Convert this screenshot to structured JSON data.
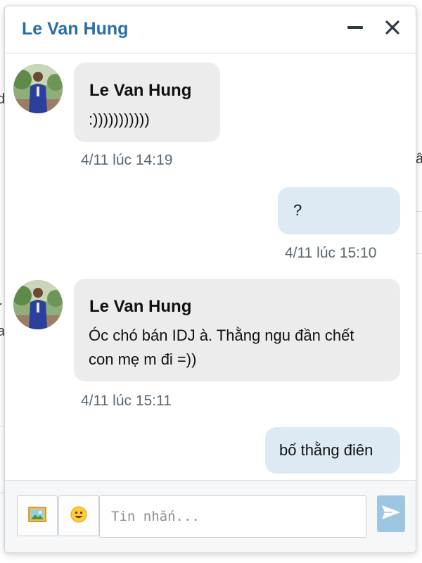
{
  "chat": {
    "title": "Le Van Hung",
    "messages": [
      {
        "direction": "in",
        "sender": "Le Van Hung",
        "text": ":)))))))))))",
        "timestamp": "4/11 lúc 14:19"
      },
      {
        "direction": "out",
        "text": "?",
        "timestamp": "4/11 lúc 15:10"
      },
      {
        "direction": "in",
        "sender": "Le Van Hung",
        "text_line1": "Óc chó bán IDJ à. Thằng ngu đần chết",
        "text_line2": "con mẹ m đi =))",
        "timestamp": "4/11 lúc 15:11"
      },
      {
        "direction": "out",
        "text": "bố thằng điên"
      }
    ]
  },
  "composer": {
    "placeholder": "Tin nhắn...",
    "image_icon": "image-icon",
    "emoji_icon": "emoji-icon",
    "send_icon": "send-icon"
  },
  "colors": {
    "title": "#2a6ea6",
    "bubble_in": "#ececec",
    "bubble_out": "#dde9f3",
    "send_button": "#9ec6e3"
  }
}
